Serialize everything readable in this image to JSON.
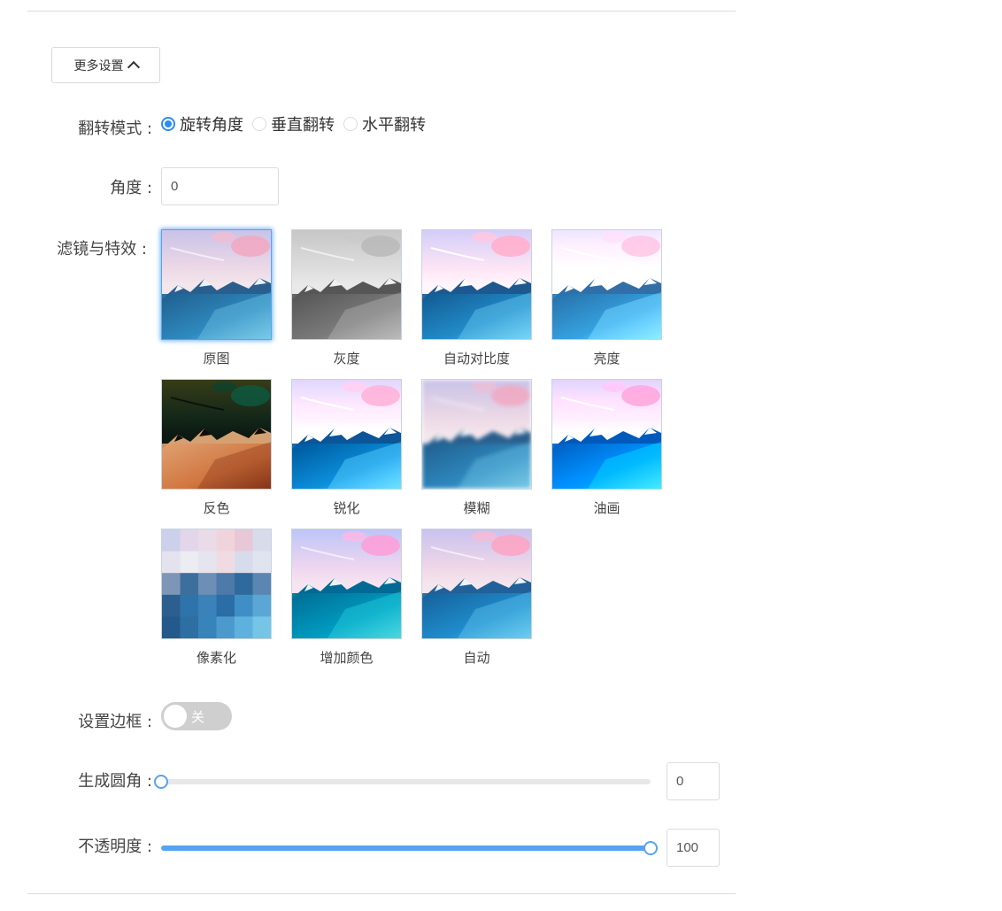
{
  "more_settings": {
    "label": "更多设置"
  },
  "flip_mode": {
    "label": "翻转模式 :",
    "options": [
      "旋转角度",
      "垂直翻转",
      "水平翻转"
    ],
    "selected_index": 0
  },
  "angle": {
    "label": "角度 :",
    "value": "0"
  },
  "filters": {
    "label": "滤镜与特效 :",
    "selected_index": 0,
    "items": [
      {
        "label": "原图"
      },
      {
        "label": "灰度"
      },
      {
        "label": "自动对比度"
      },
      {
        "label": "亮度"
      },
      {
        "label": "反色"
      },
      {
        "label": "锐化"
      },
      {
        "label": "模糊"
      },
      {
        "label": "油画"
      },
      {
        "label": "像素化"
      },
      {
        "label": "增加颜色"
      },
      {
        "label": "自动"
      }
    ]
  },
  "border": {
    "label": "设置边框 :",
    "switch_text": "关",
    "enabled": false
  },
  "corner_radius": {
    "label": "生成圆角 :",
    "value": "0",
    "fraction": 0
  },
  "opacity": {
    "label": "不透明度 :",
    "value": "100",
    "fraction": 1
  },
  "colors": {
    "accent": "#57a3f3",
    "radio_accent": "#2d8cf0",
    "switch_off": "#cfcfcf"
  }
}
